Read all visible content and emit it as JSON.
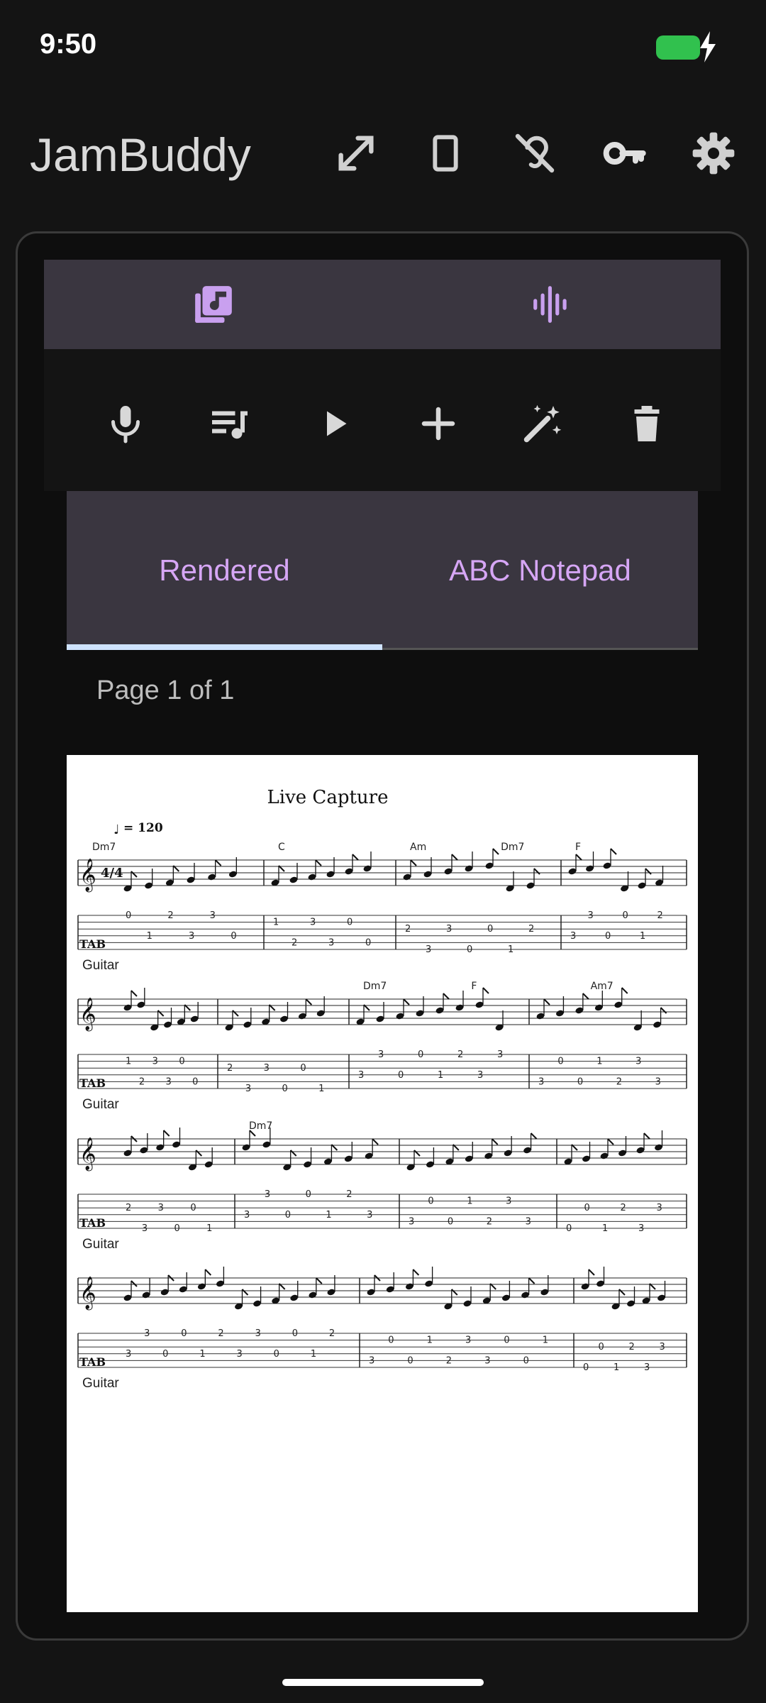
{
  "status": {
    "time": "9:50",
    "battery_color": "#31c14e"
  },
  "app": {
    "title": "JamBuddy",
    "actions": [
      {
        "name": "fullscreen-icon"
      },
      {
        "name": "rectangle-icon"
      },
      {
        "name": "hearing-off-icon"
      },
      {
        "name": "key-icon"
      },
      {
        "name": "gear-icon"
      }
    ]
  },
  "top_nav": {
    "tabs": [
      {
        "name": "library-music-icon",
        "selected": true
      },
      {
        "name": "waveform-icon",
        "selected": false
      }
    ]
  },
  "toolbar": {
    "tools": [
      "mic-icon",
      "playlist-icon",
      "play-icon",
      "add-icon",
      "magic-wand-icon",
      "trash-icon"
    ]
  },
  "view_tabs": {
    "rendered": "Rendered",
    "abc": "ABC Notepad",
    "selected": "Rendered"
  },
  "page_info": "Page 1 of 1",
  "score": {
    "title": "Live Capture",
    "tempo": "= 120",
    "instrument": "Guitar",
    "systems": [
      {
        "chords": [
          {
            "t": "Dm7",
            "m": 0
          },
          {
            "t": "C",
            "m": 1
          },
          {
            "t": "Am",
            "m": 2
          },
          {
            "t": "Dm7",
            "m": 2.55
          },
          {
            "t": "F",
            "m": 3
          }
        ]
      },
      {
        "chords": [
          {
            "t": "Dm7",
            "m": 2
          },
          {
            "t": "F",
            "m": 2.6
          },
          {
            "t": "Am7",
            "m": 3.3
          }
        ]
      },
      {
        "chords": [
          {
            "t": "Dm7",
            "m": 1
          }
        ]
      },
      {
        "chords": []
      }
    ]
  },
  "colors": {
    "accent": "#d6a6f5",
    "nav_bg": "#3a3640",
    "indicator": "#cfe3ff"
  }
}
